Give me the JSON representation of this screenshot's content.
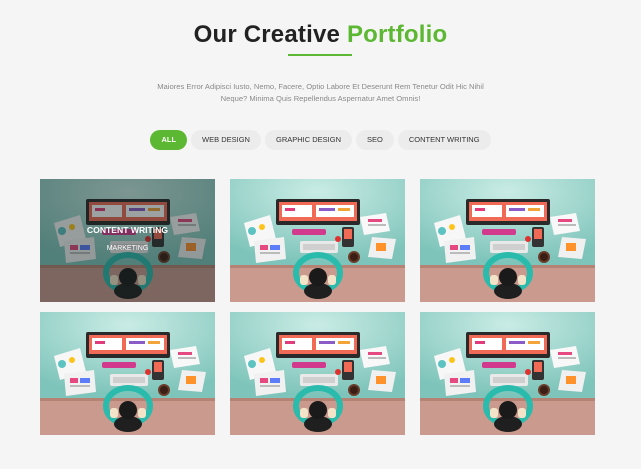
{
  "header": {
    "title_main": "Our Creative",
    "title_accent": "Portfolio",
    "subtitle": "Maiores Error Adipisci Iusto, Nemo, Facere, Optio Labore Et Deserunt Rem Tenetur Odit Hic Nihil Neque? Minima Quis Repellendus Aspernatur Amet Omnis!"
  },
  "filters": [
    {
      "label": "ALL",
      "active": true
    },
    {
      "label": "WEB DESIGN",
      "active": false
    },
    {
      "label": "GRAPHIC DESIGN",
      "active": false
    },
    {
      "label": "SEO",
      "active": false
    },
    {
      "label": "CONTENT WRITING",
      "active": false
    }
  ],
  "portfolio": {
    "hovered_item": {
      "title": "CONTENT WRITING",
      "category": "MARKETING"
    },
    "item_count": 6
  },
  "colors": {
    "accent": "#5cb832",
    "background": "#f5f5f5"
  }
}
